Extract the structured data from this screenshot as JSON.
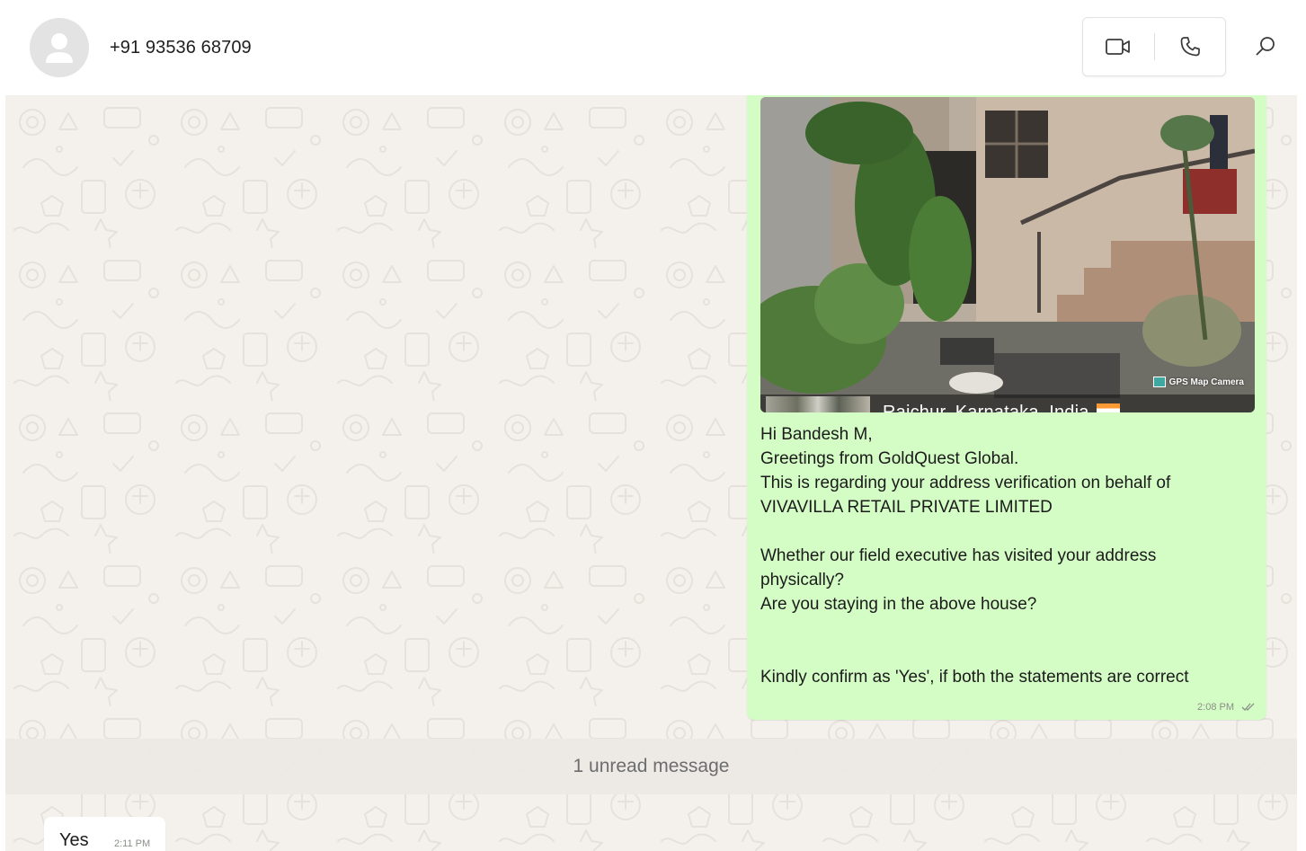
{
  "contact": {
    "name": "+91 93536 68709"
  },
  "header": {
    "video_icon": "video-camera-icon",
    "call_icon": "phone-icon",
    "search_icon": "search-icon"
  },
  "outgoing_message": {
    "photo": {
      "gps_label": "GPS Map Camera",
      "location": "Raichur, Karnataka, India"
    },
    "lines": [
      "Hi Bandesh M,",
      "Greetings from GoldQuest Global.",
      "This is regarding your address verification on behalf of",
      "VIVAVILLA RETAIL PRIVATE LIMITED",
      "",
      "Whether our field executive has visited your address",
      "physically?",
      "Are you staying in the above house?",
      "",
      "",
      "Kindly confirm as 'Yes', if both the statements are correct"
    ],
    "time": "2:08 PM",
    "status": "read"
  },
  "unread_banner": "1 unread message",
  "incoming_message": {
    "text": "Yes",
    "time": "2:11 PM"
  },
  "colors": {
    "outgoing_bubble": "#d4fcc5",
    "chat_background": "#f4f1ed",
    "incoming_bubble": "#ffffff"
  }
}
